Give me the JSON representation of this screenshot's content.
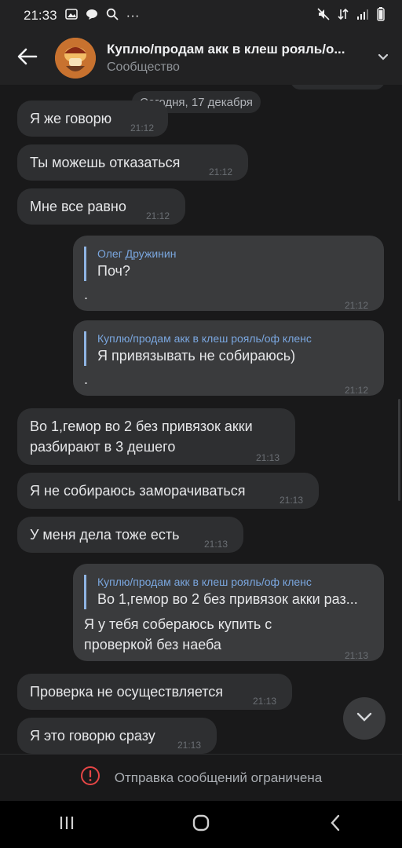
{
  "status": {
    "time": "21:33",
    "dots": "···"
  },
  "header": {
    "title": "Куплю/продам акк в клеш рояль/о...",
    "subtitle": "Сообщество"
  },
  "chat": {
    "date": "Сегодня, 17 декабря",
    "messages": [
      {
        "text": "Я же говорю",
        "time": "21:12"
      },
      {
        "text": "Ты можешь отказаться",
        "time": "21:12"
      },
      {
        "text": "Мне все равно",
        "time": "21:12"
      },
      {
        "reply_author": "Олег Дружинин",
        "reply_text": "Поч?",
        "text": ".",
        "time": "21:12"
      },
      {
        "reply_author": "Куплю/продам акк в клеш рояль/оф кленс",
        "reply_text": "Я привязывать не собираюсь)",
        "text": ".",
        "time": "21:12"
      },
      {
        "text_line1": "Во 1,гемор во 2 без привязок акки",
        "text_line2": "разбирают в 3 дешего",
        "time": "21:13"
      },
      {
        "text": "Я не собираюсь заморачиваться",
        "time": "21:13"
      },
      {
        "text": "У меня дела тоже есть",
        "time": "21:13"
      },
      {
        "reply_author": "Куплю/продам акк в клеш рояль/оф кленс",
        "reply_text": "Во 1,гемор во 2 без привязок акки раз...",
        "text_line1": "Я у тебя собераюсь купить с",
        "text_line2": "проверкой без наеба",
        "time": "21:13"
      },
      {
        "text": "Проверка не осуществляется",
        "time": "21:13"
      },
      {
        "text": "Я это говорю сразу",
        "time": "21:13"
      }
    ]
  },
  "footer": {
    "restricted": "Отправка сообщений ограничена"
  },
  "icons": {
    "back": "arrow-left-icon",
    "chevron": "chevron-down-icon",
    "scroll": "chevron-down-icon",
    "warning": "alert-circle-icon",
    "nav_recent": "recent-apps-icon",
    "nav_home": "home-icon",
    "nav_back": "back-icon"
  },
  "colors": {
    "background": "#19191a",
    "bubble_in": "#2e2f31",
    "bubble_out": "#3a3b3d",
    "accent": "#7aa6de",
    "warning": "#e64646"
  }
}
